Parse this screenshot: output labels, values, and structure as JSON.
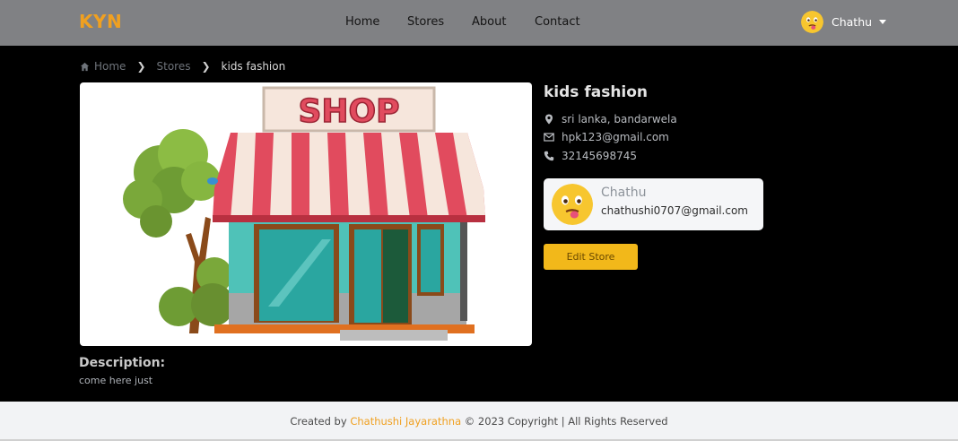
{
  "navbar": {
    "logo": "KYN",
    "links": [
      "Home",
      "Stores",
      "About",
      "Contact"
    ],
    "user_name": "Chathu"
  },
  "breadcrumb": {
    "home": "Home",
    "stores": "Stores",
    "current": "kids fashion"
  },
  "shop_image": {
    "sign_text": "SHOP"
  },
  "store": {
    "name": "kids fashion",
    "location": "sri lanka, bandarwela",
    "email": "hpk123@gmail.com",
    "phone": "32145698745"
  },
  "owner": {
    "name": "Chathu",
    "email": "chathushi0707@gmail.com"
  },
  "edit_button": "Edit Store",
  "description": {
    "title": "Description:",
    "text": "come here just"
  },
  "footer": {
    "prefix": "Created by",
    "author": "Chathushi Jayarathna",
    "suffix": "© 2023 Copyright | All Rights Reserved"
  },
  "colors": {
    "brand": "#f0a020",
    "navbar": "#808184",
    "button": "#f2b81a",
    "page_bg": "#000000"
  },
  "icons": [
    "home-icon",
    "location-pin-icon",
    "email-icon",
    "phone-icon",
    "chevron-down-icon",
    "emoji-avatar-icon"
  ]
}
